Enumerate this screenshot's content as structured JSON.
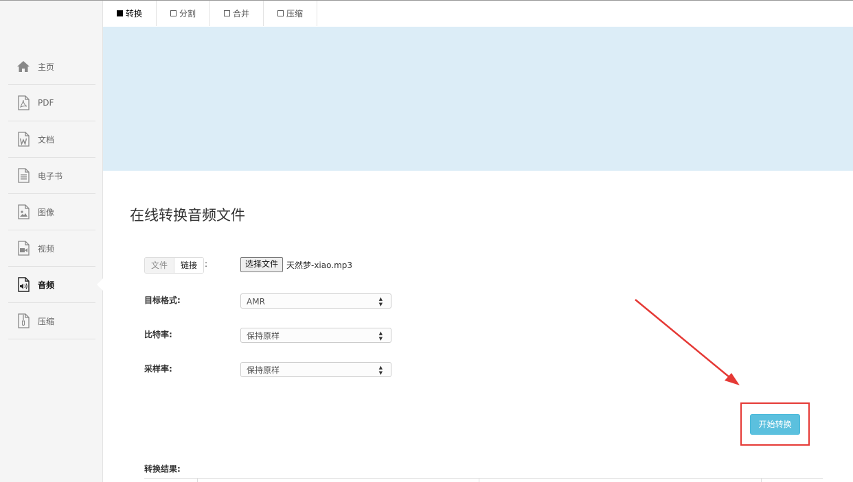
{
  "tabs": [
    {
      "label": "转换",
      "active": true
    },
    {
      "label": "分割",
      "active": false
    },
    {
      "label": "合并",
      "active": false
    },
    {
      "label": "压缩",
      "active": false
    }
  ],
  "sidebar": {
    "items": [
      {
        "label": "主页",
        "icon": "home-icon"
      },
      {
        "label": "PDF",
        "icon": "pdf-file-icon"
      },
      {
        "label": "文档",
        "icon": "word-file-icon"
      },
      {
        "label": "电子书",
        "icon": "ebook-file-icon"
      },
      {
        "label": "图像",
        "icon": "image-file-icon"
      },
      {
        "label": "视频",
        "icon": "video-file-icon"
      },
      {
        "label": "音频",
        "icon": "audio-file-icon",
        "active": true
      },
      {
        "label": "压缩",
        "icon": "archive-file-icon"
      }
    ]
  },
  "main": {
    "title": "在线转换音频文件",
    "source_toggle": {
      "file": "文件",
      "link": "链接",
      "colon": ":"
    },
    "file_button": "选择文件",
    "file_name": "天然梦-xiao.mp3",
    "fields": [
      {
        "label": "目标格式:",
        "value": "AMR"
      },
      {
        "label": "比特率:",
        "value": "保持原样"
      },
      {
        "label": "采样率:",
        "value": "保持原样"
      }
    ],
    "start_button": "开始转换",
    "result_label": "转换结果:"
  },
  "colors": {
    "banner": "#dcedf7",
    "start_button": "#5bc0de",
    "highlight": "#e53935"
  }
}
